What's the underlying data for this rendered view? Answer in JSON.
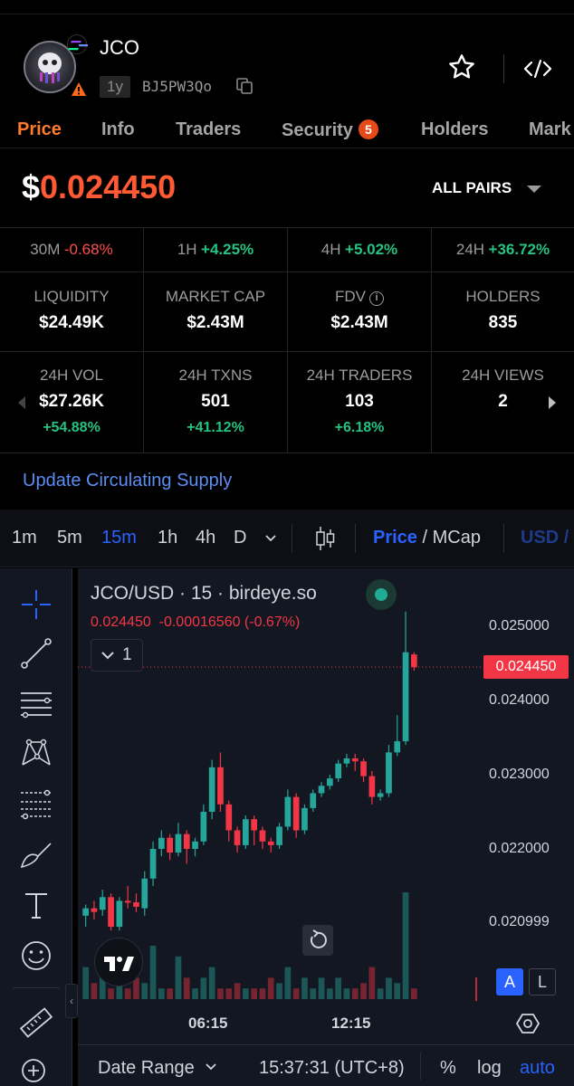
{
  "header": {
    "token_name": "JCO",
    "age": "1y",
    "address": "BJ5PW3Qo"
  },
  "tabs": [
    {
      "label": "Price",
      "active": true
    },
    {
      "label": "Info"
    },
    {
      "label": "Traders"
    },
    {
      "label": "Security",
      "badge": "5"
    },
    {
      "label": "Holders"
    },
    {
      "label": "Mark"
    }
  ],
  "price": {
    "currency": "$",
    "value": "0.024450"
  },
  "pairs_label": "ALL PAIRS",
  "changes": [
    {
      "period": "30M",
      "value": "-0.68%",
      "dir": "neg"
    },
    {
      "period": "1H",
      "value": "+4.25%",
      "dir": "pos"
    },
    {
      "period": "4H",
      "value": "+5.02%",
      "dir": "pos"
    },
    {
      "period": "24H",
      "value": "+36.72%",
      "dir": "pos"
    }
  ],
  "stats": [
    {
      "label": "LIQUIDITY",
      "value": "$24.49K"
    },
    {
      "label": "MARKET CAP",
      "value": "$2.43M"
    },
    {
      "label": "FDV",
      "value": "$2.43M"
    },
    {
      "label": "HOLDERS",
      "value": "835"
    }
  ],
  "stats24": [
    {
      "label": "24H VOL",
      "value": "$27.26K",
      "change": "+54.88%"
    },
    {
      "label": "24H TXNS",
      "value": "501",
      "change": "+41.12%"
    },
    {
      "label": "24H TRADERS",
      "value": "103",
      "change": "+6.18%"
    },
    {
      "label": "24H VIEWS",
      "value": "2",
      "change": ""
    }
  ],
  "update_link": "Update Circulating Supply",
  "chart_toolbar": {
    "timeframes": [
      "1m",
      "5m",
      "15m",
      "1h",
      "4h",
      "D"
    ],
    "active_timeframe": "15m",
    "price_label": "Price",
    "slash": " / ",
    "mcap_label": "MCap",
    "currency": "USD",
    "currency_trail": " /"
  },
  "chart": {
    "title": "JCO/USD · 15 · birdeye.so",
    "ohlc_price": "0.024450",
    "ohlc_change": "-0.00016560 (-0.67%)",
    "indicator_count": "1",
    "current_price_label": "0.024450",
    "y_ticks": [
      "0.025000",
      "0.024000",
      "0.023000",
      "0.022000",
      "0.020999"
    ],
    "x_ticks": [
      "06:15",
      "12:15"
    ],
    "scale_a": "A",
    "scale_l": "L",
    "date_range": "Date Range",
    "clock": "15:37:31 (UTC+8)",
    "pct": "%",
    "log": "log",
    "auto": "auto",
    "colors": {
      "up": "#26a69a",
      "down": "#f23645",
      "bg": "#131722"
    }
  },
  "chart_data": {
    "type": "candlestick",
    "ylim": [
      0.0205,
      0.0252
    ],
    "candles": [
      {
        "o": 0.0211,
        "c": 0.0212,
        "h": 0.02125,
        "l": 0.02095
      },
      {
        "o": 0.0212,
        "c": 0.02115,
        "h": 0.0213,
        "l": 0.02105
      },
      {
        "o": 0.02118,
        "c": 0.02135,
        "h": 0.02145,
        "l": 0.0211
      },
      {
        "o": 0.02135,
        "c": 0.02095,
        "h": 0.0214,
        "l": 0.0209
      },
      {
        "o": 0.02095,
        "c": 0.0213,
        "h": 0.02135,
        "l": 0.0209
      },
      {
        "o": 0.0213,
        "c": 0.02128,
        "h": 0.0215,
        "l": 0.0212
      },
      {
        "o": 0.02128,
        "c": 0.02122,
        "h": 0.0214,
        "l": 0.02115
      },
      {
        "o": 0.0212,
        "c": 0.0216,
        "h": 0.0217,
        "l": 0.0211
      },
      {
        "o": 0.0216,
        "c": 0.022,
        "h": 0.0221,
        "l": 0.0215
      },
      {
        "o": 0.022,
        "c": 0.02215,
        "h": 0.02225,
        "l": 0.0219
      },
      {
        "o": 0.02215,
        "c": 0.02195,
        "h": 0.0222,
        "l": 0.02185
      },
      {
        "o": 0.02195,
        "c": 0.0222,
        "h": 0.02235,
        "l": 0.0219
      },
      {
        "o": 0.0222,
        "c": 0.022,
        "h": 0.02225,
        "l": 0.0218
      },
      {
        "o": 0.022,
        "c": 0.0221,
        "h": 0.02215,
        "l": 0.0219
      },
      {
        "o": 0.0221,
        "c": 0.0225,
        "h": 0.0226,
        "l": 0.02205
      },
      {
        "o": 0.0225,
        "c": 0.0231,
        "h": 0.0232,
        "l": 0.0224
      },
      {
        "o": 0.0231,
        "c": 0.0226,
        "h": 0.0233,
        "l": 0.0225
      },
      {
        "o": 0.0226,
        "c": 0.02225,
        "h": 0.02265,
        "l": 0.0221
      },
      {
        "o": 0.02225,
        "c": 0.02205,
        "h": 0.0223,
        "l": 0.02195
      },
      {
        "o": 0.02205,
        "c": 0.0224,
        "h": 0.02245,
        "l": 0.022
      },
      {
        "o": 0.0224,
        "c": 0.02225,
        "h": 0.02245,
        "l": 0.02205
      },
      {
        "o": 0.02225,
        "c": 0.0221,
        "h": 0.0223,
        "l": 0.022
      },
      {
        "o": 0.0221,
        "c": 0.02205,
        "h": 0.02215,
        "l": 0.02195
      },
      {
        "o": 0.02205,
        "c": 0.0223,
        "h": 0.02235,
        "l": 0.022
      },
      {
        "o": 0.0223,
        "c": 0.0227,
        "h": 0.0228,
        "l": 0.02225
      },
      {
        "o": 0.0227,
        "c": 0.02225,
        "h": 0.02275,
        "l": 0.02215
      },
      {
        "o": 0.02225,
        "c": 0.02255,
        "h": 0.0226,
        "l": 0.0222
      },
      {
        "o": 0.02255,
        "c": 0.02275,
        "h": 0.0228,
        "l": 0.0225
      },
      {
        "o": 0.02275,
        "c": 0.02285,
        "h": 0.0229,
        "l": 0.0227
      },
      {
        "o": 0.02285,
        "c": 0.02295,
        "h": 0.023,
        "l": 0.0228
      },
      {
        "o": 0.02295,
        "c": 0.02315,
        "h": 0.0232,
        "l": 0.0229
      },
      {
        "o": 0.02315,
        "c": 0.02322,
        "h": 0.02328,
        "l": 0.0231
      },
      {
        "o": 0.02322,
        "c": 0.02318,
        "h": 0.02328,
        "l": 0.02305
      },
      {
        "o": 0.02318,
        "c": 0.02298,
        "h": 0.02322,
        "l": 0.0229
      },
      {
        "o": 0.02298,
        "c": 0.0227,
        "h": 0.02305,
        "l": 0.0226
      },
      {
        "o": 0.0227,
        "c": 0.02275,
        "h": 0.0228,
        "l": 0.02265
      },
      {
        "o": 0.02275,
        "c": 0.0233,
        "h": 0.0234,
        "l": 0.0227
      },
      {
        "o": 0.0233,
        "c": 0.02345,
        "h": 0.0238,
        "l": 0.02325
      },
      {
        "o": 0.02345,
        "c": 0.02465,
        "h": 0.0252,
        "l": 0.0234
      },
      {
        "o": 0.02462,
        "c": 0.02445,
        "h": 0.02465,
        "l": 0.0244
      }
    ],
    "volumes": [
      0.3,
      0.15,
      0.25,
      0.1,
      0.3,
      0.1,
      0.2,
      0.15,
      0.5,
      0.1,
      0.1,
      0.4,
      0.2,
      0.1,
      0.2,
      0.3,
      0.1,
      0.1,
      0.15,
      0.1,
      0.1,
      0.1,
      0.2,
      0.15,
      0.3,
      0.1,
      0.2,
      0.1,
      0.2,
      0.1,
      0.2,
      0.1,
      0.1,
      0.15,
      0.3,
      0.1,
      0.2,
      0.15,
      1.0,
      0.1
    ]
  }
}
